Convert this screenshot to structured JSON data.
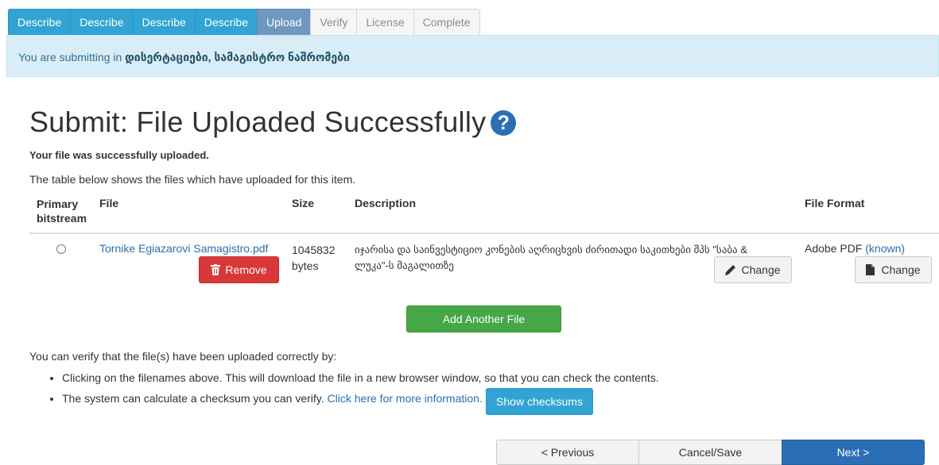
{
  "steps": [
    {
      "label": "Describe",
      "state": "done"
    },
    {
      "label": "Describe",
      "state": "done"
    },
    {
      "label": "Describe",
      "state": "done"
    },
    {
      "label": "Describe",
      "state": "done"
    },
    {
      "label": "Upload",
      "state": "current"
    },
    {
      "label": "Verify",
      "state": "todo"
    },
    {
      "label": "License",
      "state": "todo"
    },
    {
      "label": "Complete",
      "state": "todo"
    }
  ],
  "alert": {
    "prefix": "You are submitting in ",
    "collection": "დისერტაციები, სამაგისტრო ნაშრომები"
  },
  "page": {
    "title": "Submit: File Uploaded Successfully",
    "success": "Your file was successfully uploaded.",
    "intro": "The table below shows the files which have uploaded for this item."
  },
  "table": {
    "headers": {
      "primary_line1": "Primary",
      "primary_line2": "bitstream",
      "file": "File",
      "size": "Size",
      "description": "Description",
      "format": "File Format"
    },
    "row": {
      "filename": "Tornike Egiazarovi Samagistro.pdf",
      "remove_label": "Remove",
      "size_value": "1045832",
      "size_unit": "bytes",
      "description_line1": "იჯარისა და საინვესტიციო კონების აღრიცხვის ძირითადი საკითხები შპს \"საბა &",
      "description_line2": "ლუკა\"-ს მაგალითზე",
      "change_desc_label": "Change",
      "format_name": "Adobe PDF",
      "format_known": "(known)",
      "change_format_label": "Change"
    }
  },
  "add_file_label": "Add Another File",
  "verify": {
    "intro": "You can verify that the file(s) have been uploaded correctly by:",
    "bullet1": "Clicking on the filenames above. This will download the file in a new browser window, so that you can check the contents.",
    "bullet2_text": "The system can calculate a checksum you can verify.",
    "bullet2_link": "Click here for more information.",
    "show_checksums": "Show checksums"
  },
  "nav": {
    "previous": "< Previous",
    "cancel": "Cancel/Save",
    "next": "Next >"
  },
  "colors": {
    "step_done": "#31a4d4",
    "step_current": "#6f98c0",
    "alert_bg": "#d9edf7",
    "danger": "#d9383a",
    "success": "#45a745",
    "primary": "#2a6fb5"
  },
  "icons": {
    "help": "help-circle-icon",
    "trash": "trash-icon",
    "pencil": "pencil-icon",
    "file": "file-icon"
  }
}
